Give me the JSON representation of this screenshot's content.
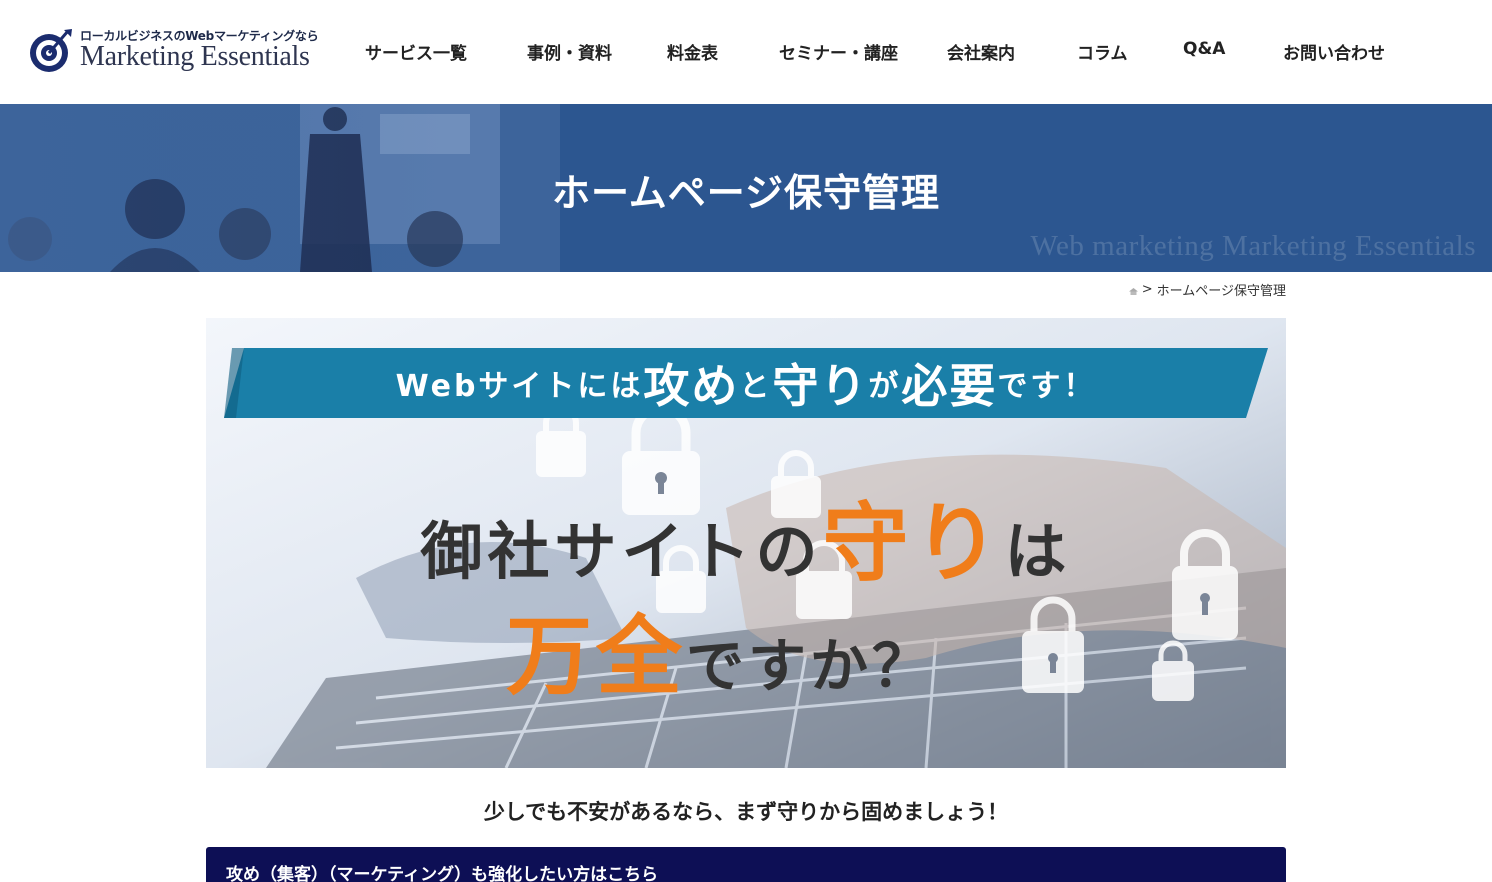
{
  "header": {
    "logo_tagline": "ローカルビジネスのWebマーケティングなら",
    "logo_name": "Marketing Essentials",
    "logo_icon": "target-logo-icon",
    "nav": [
      {
        "label": "サービス一覧"
      },
      {
        "label": "事例・資料"
      },
      {
        "label": "料金表"
      },
      {
        "label": "セミナー・講座"
      },
      {
        "label": "会社案内"
      },
      {
        "label": "コラム"
      },
      {
        "label": "Q&A"
      },
      {
        "label": "お問い合わせ"
      }
    ]
  },
  "hero": {
    "title": "ホームページ保守管理",
    "watermark": "Web marketing Marketing Essentials",
    "background_color": "#2c5690"
  },
  "breadcrumb": {
    "home_icon": "home-icon",
    "separator": ">",
    "current": "ホームページ保守管理"
  },
  "banner": {
    "ribbon_a": "Webサイトには",
    "ribbon_b": "攻め",
    "ribbon_c": "と",
    "ribbon_d": "守り",
    "ribbon_e": "が",
    "ribbon_f": "必要",
    "ribbon_g": "です！",
    "line1_a": "御社サイトの",
    "line1_b": "守り",
    "line1_c": "は",
    "line2_a": "万全",
    "line2_b": "ですか？",
    "accent_color": "#f07d1a",
    "ribbon_color": "#1a7fa8"
  },
  "lead": "少しでも不安があるなら、まず守りから固めましょう！",
  "cta": {
    "label": "攻め（集客）（マーケティング）も強化したい方はこちら",
    "background_color": "#0d0f55"
  }
}
